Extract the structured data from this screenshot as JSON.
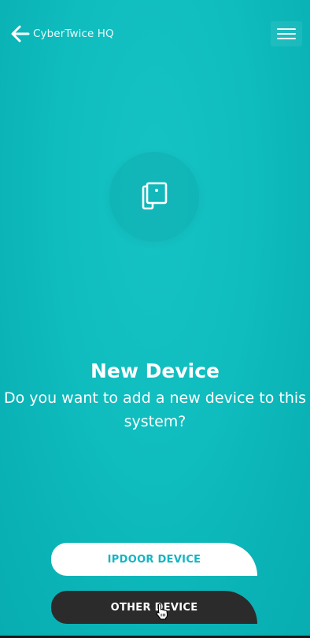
{
  "header": {
    "title": "CyberTwice HQ",
    "back_icon": "arrow-left-icon",
    "menu_icon": "hamburger-menu-icon"
  },
  "hero": {
    "icon": "devices-icon"
  },
  "main": {
    "title": "New Device",
    "question": "Do you want to add a new device to this system?"
  },
  "buttons": {
    "ipdoor_label": "IPDOOR DEVICE",
    "other_label": "OTHER DEVICE"
  },
  "colors": {
    "background": "#10BCBE",
    "accent_text": "#15B4C3",
    "dark_button": "#2B2B2B",
    "light_button": "#FFFFFF"
  }
}
